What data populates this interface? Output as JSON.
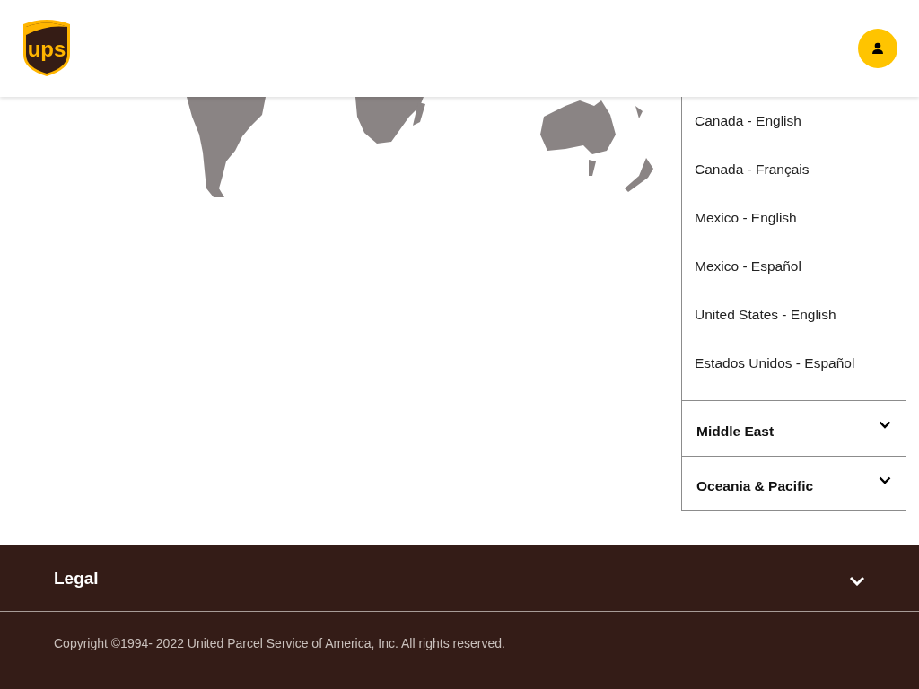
{
  "header": {
    "logo": {
      "text": "ups"
    }
  },
  "country_list": [
    {
      "label": "Canada - English"
    },
    {
      "label": "Canada - Français"
    },
    {
      "label": "Mexico - English"
    },
    {
      "label": "Mexico - Español"
    },
    {
      "label": "United States - English"
    },
    {
      "label": "Estados Unidos - Español"
    }
  ],
  "regions": [
    {
      "name": "Middle East",
      "expanded": false
    },
    {
      "name": "Oceania & Pacific",
      "expanded": false
    }
  ],
  "footer": {
    "legal": {
      "label": "Legal",
      "expanded": false
    },
    "copyright": "Copyright ©1994- 2022  United Parcel Service of America, Inc. All rights reserved."
  }
}
